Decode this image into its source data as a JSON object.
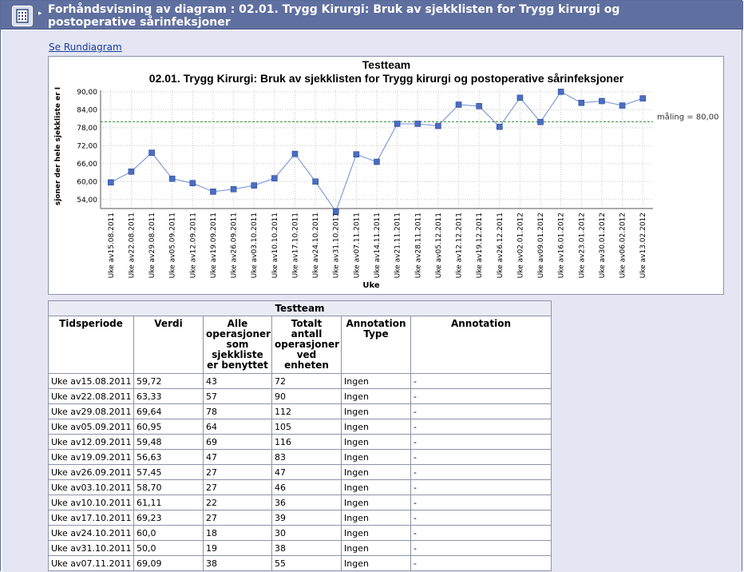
{
  "header": {
    "title": "Forhåndsvisning av diagram : 02.01. Trygg Kirurgi: Bruk av sjekklisten for Trygg kirurgi og postoperative sårinfeksjoner"
  },
  "link": {
    "label": "Se Rundiagram"
  },
  "chart_data": {
    "type": "line",
    "title": "Testteam",
    "subtitle": "02.01. Trygg Kirurgi: Bruk av sjekklisten for Trygg kirurgi og postoperative sårinfeksjoner",
    "xlabel": "Uke",
    "ylabel": "sjoner der hele sjekkliste er I",
    "ylim": [
      51,
      90.5
    ],
    "yticks": [
      "90,00",
      "84,00",
      "78,00",
      "72,00",
      "66,00",
      "60,00",
      "54,00"
    ],
    "ytick_values": [
      90,
      84,
      78,
      72,
      66,
      60,
      54
    ],
    "grid": true,
    "x": [
      "Uke av15.08.2011",
      "Uke av22.08.2011",
      "Uke av29.08.2011",
      "Uke av05.09.2011",
      "Uke av12.09.2011",
      "Uke av19.09.2011",
      "Uke av26.09.2011",
      "Uke av03.10.2011",
      "Uke av10.10.2011",
      "Uke av17.10.2011",
      "Uke av24.10.2011",
      "Uke av31.10.2011",
      "Uke av07.11.2011",
      "Uke av14.11.2011",
      "Uke av21.11.2011",
      "Uke av28.11.2011",
      "Uke av05.12.2011",
      "Uke av12.12.2011",
      "Uke av19.12.2011",
      "Uke av26.12.2011",
      "Uke av02.01.2012",
      "Uke av09.01.2012",
      "Uke av16.01.2012",
      "Uke av23.01.2012",
      "Uke av30.01.2012",
      "Uke av06.02.2012",
      "Uke av13.02.2012"
    ],
    "series": [
      {
        "values": [
          59.72,
          63.33,
          69.64,
          60.95,
          59.48,
          56.63,
          57.45,
          58.7,
          61.11,
          69.23,
          60.0,
          50.0,
          69.09,
          66.6,
          79.3,
          79.3,
          78.6,
          85.7,
          85.2,
          78.3,
          88.0,
          79.9,
          90.0,
          86.3,
          86.9,
          85.4,
          87.8
        ]
      }
    ],
    "reference_line": {
      "value": 80,
      "label": "måling = 80,00",
      "color": "#2e8b2e"
    },
    "line_color": "#6b8cd6",
    "marker_color": "#4a6dc2"
  },
  "table": {
    "caption": "Testteam",
    "headers": [
      "Tidsperiode",
      "Verdi",
      "Alle operasjoner som sjekkliste er benyttet",
      "Totalt antall operasjoner ved enheten",
      "Annotation Type",
      "Annotation"
    ],
    "rows": [
      [
        "Uke av15.08.2011",
        "59,72",
        "43",
        "72",
        "Ingen",
        "-"
      ],
      [
        "Uke av22.08.2011",
        "63,33",
        "57",
        "90",
        "Ingen",
        "-"
      ],
      [
        "Uke av29.08.2011",
        "69,64",
        "78",
        "112",
        "Ingen",
        "-"
      ],
      [
        "Uke av05.09.2011",
        "60,95",
        "64",
        "105",
        "Ingen",
        "-"
      ],
      [
        "Uke av12.09.2011",
        "59,48",
        "69",
        "116",
        "Ingen",
        "-"
      ],
      [
        "Uke av19.09.2011",
        "56,63",
        "47",
        "83",
        "Ingen",
        "-"
      ],
      [
        "Uke av26.09.2011",
        "57,45",
        "27",
        "47",
        "Ingen",
        "-"
      ],
      [
        "Uke av03.10.2011",
        "58,70",
        "27",
        "46",
        "Ingen",
        "-"
      ],
      [
        "Uke av10.10.2011",
        "61,11",
        "22",
        "36",
        "Ingen",
        "-"
      ],
      [
        "Uke av17.10.2011",
        "69,23",
        "27",
        "39",
        "Ingen",
        "-"
      ],
      [
        "Uke av24.10.2011",
        "60,0",
        "18",
        "30",
        "Ingen",
        "-"
      ],
      [
        "Uke av31.10.2011",
        "50,0",
        "19",
        "38",
        "Ingen",
        "-"
      ],
      [
        "Uke av07.11.2011",
        "69,09",
        "38",
        "55",
        "Ingen",
        "-"
      ]
    ]
  }
}
